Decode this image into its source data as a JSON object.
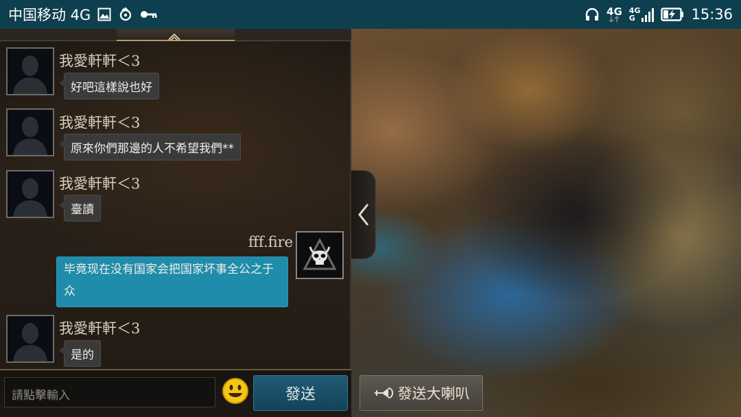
{
  "status_bar": {
    "carrier": "中国移动 4G",
    "network_badge_top": "4G",
    "network2_badge_top": "4G",
    "network2_badge_bottom": "G",
    "time": "15:36"
  },
  "chat": {
    "messages": [
      {
        "sender": "我愛軒軒＜3",
        "text": "好吧這樣說也好"
      },
      {
        "sender": "我愛軒軒＜3",
        "text": "原來你們那邊的人不希望我們**"
      },
      {
        "sender": "我愛軒軒＜3",
        "text": "臺讀"
      },
      {
        "sender": "fff.fire",
        "text": "毕竟现在没有国家会把国家坏事全公之于众",
        "self": true
      },
      {
        "sender": "我愛軒軒＜3",
        "text": "是的"
      }
    ]
  },
  "input": {
    "placeholder": "請點擊輸入",
    "send_label": "發送",
    "horn_label": "發送大喇叭"
  },
  "colors": {
    "statusbar_bg": "#0e3f4f",
    "self_bubble": "#1f8cab",
    "other_bubble": "#3a3a3a",
    "send_button": "#1f5a73"
  }
}
